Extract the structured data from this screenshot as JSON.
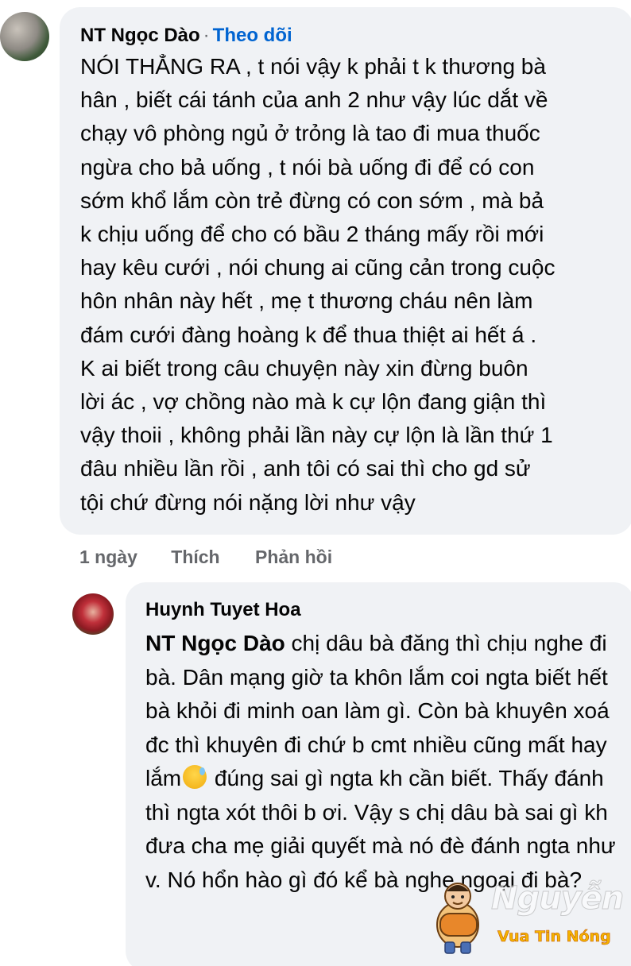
{
  "comment": {
    "author": "NT Ngọc Dào",
    "separator": "·",
    "follow_label": "Theo dõi",
    "text": "NÓI THẲNG RA , t nói vậy k phải t k thương bà\nhân , biết cái tánh của anh 2 như vậy lúc dắt về\nchạy vô phòng ngủ ở trỏng là tao đi mua thuốc\nngừa cho bả uống , t nói bà uống đi để có con\nsớm khổ lắm còn trẻ đừng có con sớm , mà bả\nk chịu uống để cho có bầu 2 tháng mấy rồi mới\nhay kêu cưới , nói chung ai cũng cản trong cuộc\nhôn nhân này hết , mẹ t thương cháu nên làm\nđám cưới đàng hoàng k để thua thiệt ai hết á .\nK ai biết trong câu chuyện này xin đừng buôn\nlời ác , vợ chồng nào mà k cự lộn đang giận thì\nvậy thoii , không phải lần này cự lộn là lần thứ 1\nđâu nhiều lần rồi , anh tôi có sai thì cho gd sử\ntội chứ đừng nói nặng lời như vậy",
    "time": "1 ngày",
    "like_label": "Thích",
    "reply_label": "Phản hồi"
  },
  "reply": {
    "author": "Huynh Tuyet Hoa",
    "mention": "NT Ngọc Dào",
    "text_part1": " chị dâu bà đăng thì chịu nghe đi bà. Dân mạng giờ ta khôn lắm coi ngta biết hết bà khỏi đi minh oan làm gì. Còn bà khuyên xoá đc thì khuyên đi chứ b cmt nhiều cũng mất hay lắm",
    "text_part2": " đúng sai gì ngta kh cần biết. Thấy đánh thì ngta xót thôi b ơi. Vậy s chị dâu bà sai gì kh đưa cha mẹ giải quyết mà nó đè đánh ngta như v. Nó hổn hào gì đó kể bà nghe ngoại đi bà?",
    "emoji_icon": "grinning-face-with-sweat-icon"
  },
  "watermark": {
    "name": "Nguyễn Sin",
    "tagline": "Vua Tin Nóng"
  },
  "colors": {
    "bubble_bg": "#f0f2f5",
    "link_blue": "#0064d1",
    "muted_text": "#65676b",
    "text": "#050505"
  }
}
